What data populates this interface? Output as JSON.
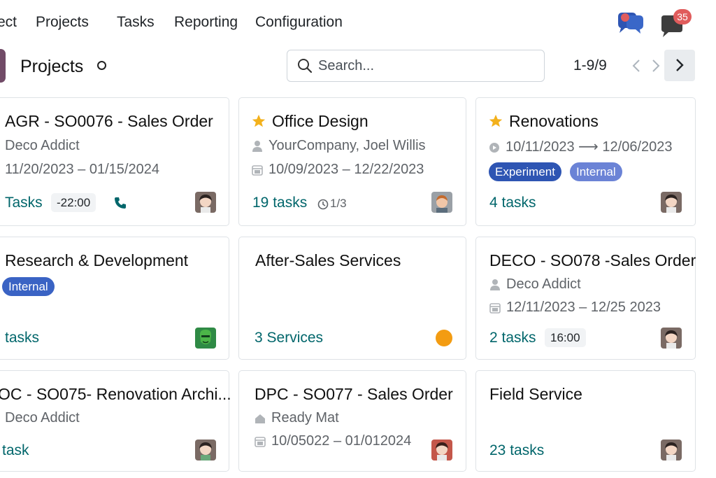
{
  "nav": {
    "app_partial": "ect",
    "items": [
      "Projects",
      "Tasks",
      "Reporting",
      "Configuration"
    ],
    "messages_badge": "35"
  },
  "control": {
    "title": "Projects",
    "search_placeholder": "Search...",
    "pager": "1-9/9"
  },
  "cards": [
    {
      "title": "AGR - SO0076 - Sales Order",
      "customer": "Deco Addict",
      "dates": "11/20/2023  –  01/15/2024",
      "tasks": "Tasks",
      "time": "-22:00",
      "phone_icon": "phone-icon",
      "avatar": "woman-dark-hair"
    },
    {
      "title": "Office Design",
      "favorite": true,
      "customer": "YourCompany, Joel Willis",
      "dates": "10/09/2023  –  12/22/2023",
      "tasks": "19 tasks",
      "milestones": "1/3",
      "avatar": "man-ginger"
    },
    {
      "title": "Renovations",
      "favorite": true,
      "dates": "10/11/2023  ⟶  12/06/2023",
      "tags": [
        "Experiment",
        "Internal"
      ],
      "tasks": "4 tasks",
      "avatar": "woman-dark-hair"
    },
    {
      "title": "Research & Development",
      "tags": [
        "Internal"
      ],
      "tasks": "tasks",
      "avatar": "green-mask"
    },
    {
      "title": "After-Sales Services",
      "tasks": "3 Services",
      "status_color": "#f39c12"
    },
    {
      "title": "DECO - SO078 -Sales Order",
      "customer": "Deco Addict",
      "dates": "12/11/2023  –  12/25 2023",
      "tasks": "2 tasks",
      "time": "16:00",
      "avatar": "woman-dark-hair"
    },
    {
      "title": "OC - SO075- Renovation Archi...",
      "customer": "Deco Addict",
      "tasks": "task",
      "avatar": "woman-dark-hair"
    },
    {
      "title": "DPC - SO077 - Sales Order",
      "customer": "Ready Mat",
      "dates": "10/05022  –  01/012024",
      "tasks": "",
      "avatar": "woman-red"
    },
    {
      "title": "Field Service",
      "tasks": "23 tasks",
      "avatar": "woman-dark-hair"
    }
  ],
  "colors": {
    "brand": "#714b67",
    "link": "#01666b",
    "tag_experiment": "#2e55b3",
    "tag_internal": "#6b83d6",
    "badge": "#e05c5c"
  }
}
